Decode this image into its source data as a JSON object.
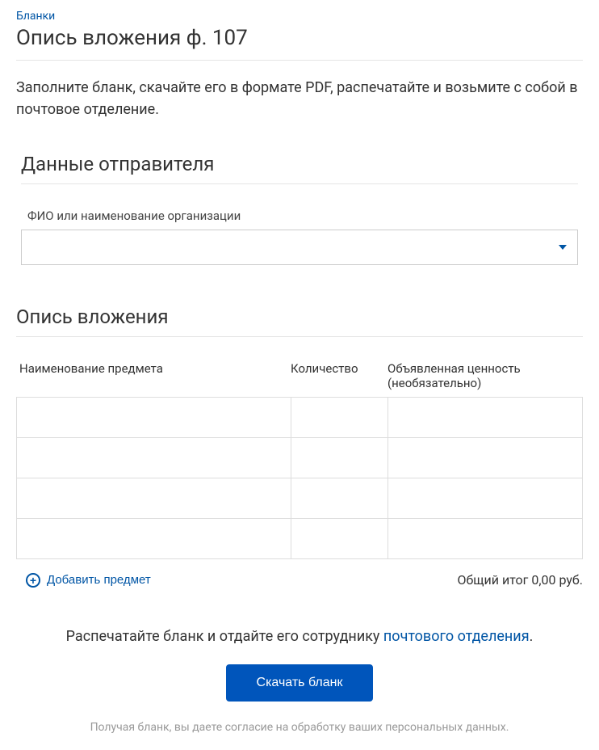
{
  "breadcrumb": "Бланки",
  "page_title": "Опись вложения ф. 107",
  "intro": "Заполните бланк, скачайте его в формате PDF, распечатайте и возьмите с собой в почтовое отделение.",
  "sender": {
    "section_title": "Данные отправителя",
    "name_label": "ФИО или наименование организации",
    "name_value": ""
  },
  "inventory": {
    "section_title": "Опись вложения",
    "columns": {
      "name": "Наименование предмета",
      "qty": "Количество",
      "value": "Объявленная ценность (необязательно)"
    },
    "rows": [
      {
        "name": "",
        "qty": "",
        "value": ""
      },
      {
        "name": "",
        "qty": "",
        "value": ""
      },
      {
        "name": "",
        "qty": "",
        "value": ""
      },
      {
        "name": "",
        "qty": "",
        "value": ""
      }
    ],
    "add_item_label": "Добавить предмет",
    "total_prefix": "Общий итог ",
    "total_value": "0,00 руб."
  },
  "print": {
    "text_before": "Распечатайте бланк и отдайте его сотруднику ",
    "link": "почтового отделения",
    "text_after": "."
  },
  "download_label": "Скачать бланк",
  "consent": "Получая бланк, вы даете согласие на обработку ваших персональных данных."
}
